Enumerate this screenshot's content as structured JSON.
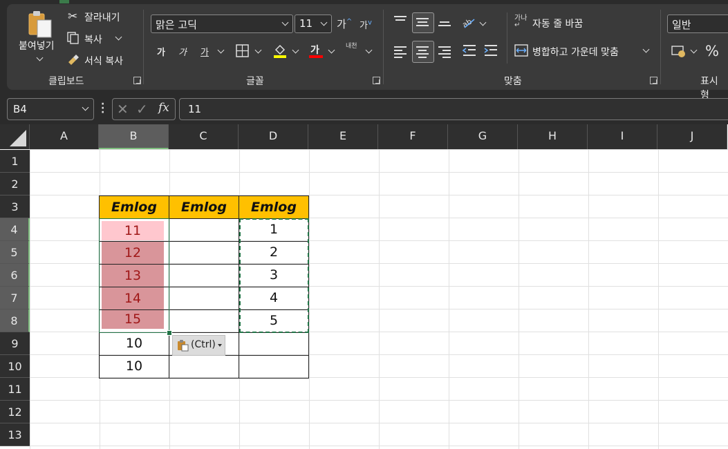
{
  "ribbon": {
    "clipboard": {
      "paste_label": "붙여넣기",
      "cut_label": "잘라내기",
      "copy_label": "복사",
      "format_painter_label": "서식 복사",
      "group_label": "클립보드"
    },
    "font": {
      "font_name": "맑은 고딕",
      "font_size": "11",
      "grow_label": "가",
      "shrink_label": "가",
      "bold_label": "가",
      "italic_label": "가",
      "underline_label": "가",
      "font_color_label": "가",
      "phonetic_label": "내천",
      "group_label": "글꼴",
      "font_color": "#ff0000",
      "fill_color": "#ffff00"
    },
    "alignment": {
      "wrap_text_label": "자동 줄 바꿈",
      "merge_center_label": "병합하고 가운데 맞춤",
      "group_label": "맞춤"
    },
    "number": {
      "format": "일반",
      "percent_label": "%",
      "group_label": "표시 형"
    }
  },
  "formula_bar": {
    "name_box": "B4",
    "formula": "11"
  },
  "columns": [
    "A",
    "B",
    "C",
    "D",
    "E",
    "F",
    "G",
    "H",
    "I",
    "J"
  ],
  "rows": [
    "1",
    "2",
    "3",
    "4",
    "5",
    "6",
    "7",
    "8",
    "9",
    "10",
    "11",
    "12",
    "13"
  ],
  "sheet": {
    "header_text": "Emlog",
    "column_b": [
      "11",
      "12",
      "13",
      "14",
      "15",
      "10",
      "10"
    ],
    "column_d": [
      "1",
      "2",
      "3",
      "4",
      "5"
    ],
    "header_fill": "#ffc000",
    "highlight_fill": "#d9959a",
    "first_highlight_fill": "#ffc7ce",
    "text_color_highlight": "#9c0006"
  },
  "paste_options": {
    "label": "(Ctrl)"
  }
}
